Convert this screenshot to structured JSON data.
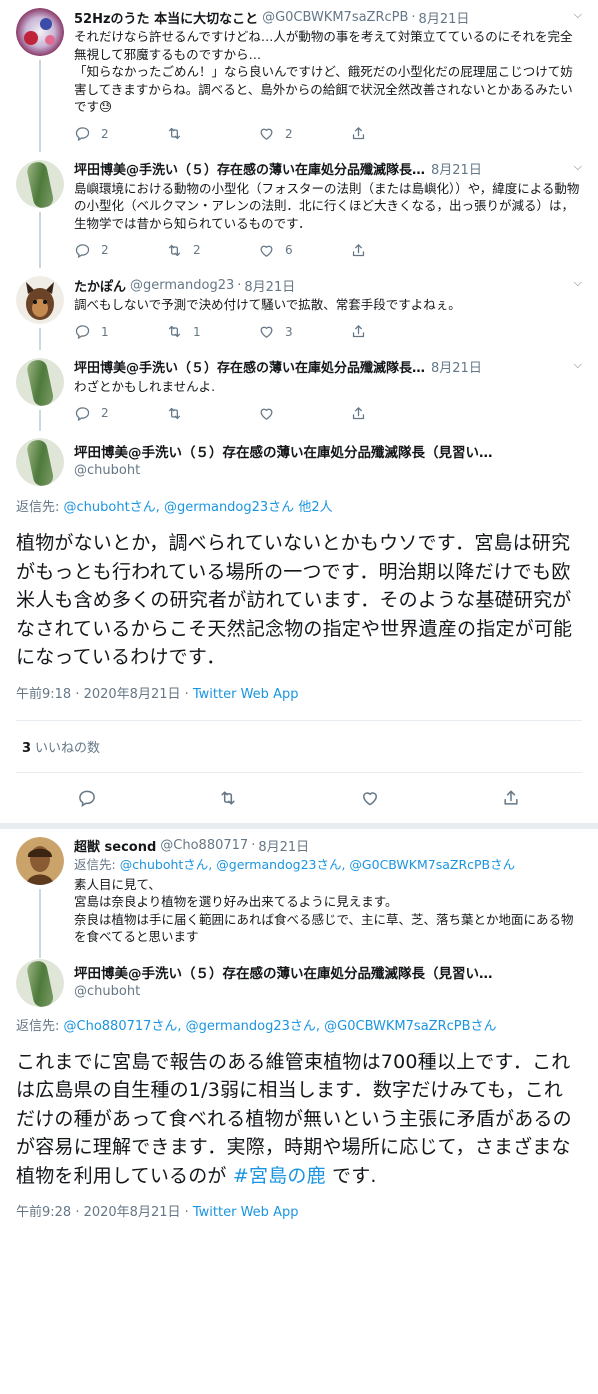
{
  "tweets": [
    {
      "name": "52Hzのうた 本当に大切なこと",
      "handle": "@G0CBWKM7saZRcPB",
      "date": "8月21日",
      "text": "それだけなら許せるんですけどね…人が動物の事を考えて対策立てているのにそれを完全無視して邪魔するものですから…\n「知らなかったごめん！」なら良いんですけど、餓死だの小型化だの屁理屈こじつけて妨害してきますからね。調べると、島外からの給餌で状況全然改善されないとかあるみたいです😓",
      "replies": "2",
      "retweets": "",
      "likes": "2"
    },
    {
      "name": "坪田博美@手洗い（５）存在感の薄い在庫処分品殲滅隊長…",
      "handle": "",
      "date": "8月21日",
      "text": "島嶼環境における動物の小型化（フォスターの法則（または島嶼化））や，緯度による動物の小型化（ベルクマン・アレンの法則．北に行くほど大きくなる，出っ張りが減る）は，生物学では昔から知られているものです．",
      "replies": "2",
      "retweets": "2",
      "likes": "6"
    },
    {
      "name": "たかぽん",
      "handle": "@germandog23",
      "date": "8月21日",
      "text": "調べもしないで予測で決め付けて騒いで拡散、常套手段ですよねぇ。",
      "replies": "1",
      "retweets": "1",
      "likes": "3"
    },
    {
      "name": "坪田博美@手洗い（５）存在感の薄い在庫処分品殲滅隊長…",
      "handle": "",
      "date": "8月21日",
      "text": "わざとかもしれませんよ.",
      "replies": "2",
      "retweets": "",
      "likes": ""
    }
  ],
  "main1": {
    "name": "坪田博美@手洗い（５）存在感の薄い在庫処分品殲滅隊長（見習い…",
    "handle": "@chuboht",
    "reply_prefix": "返信先: ",
    "reply_links": "@chubohtさん, @germandog23さん",
    "reply_more": " 他2人",
    "text": "植物がないとか，調べられていないとかもウソです．宮島は研究がもっとも行われている場所の一つです．明治期以降だけでも欧米人も含め多くの研究者が訪れています．そのような基礎研究がなされているからこそ天然記念物の指定や世界遺産の指定が可能になっているわけです．",
    "time": "午前9:18 · 2020年8月21日 · ",
    "source": "Twitter Web App",
    "likes_count": "3",
    "likes_label": "いいねの数"
  },
  "tweet5": {
    "name": "超獣 second",
    "handle": "@Cho880717",
    "date": "8月21日",
    "reply_prefix": "返信先: ",
    "reply_links": "@chubohtさん, @germandog23さん, @G0CBWKM7saZRcPBさん",
    "text": "素人目に見て、\n宮島は奈良より植物を選り好み出来てるように見えます。\n奈良は植物は手に届く範囲にあれば食べる感じで、主に草、芝、落ち葉とか地面にある物を食べてると思います"
  },
  "main2": {
    "name": "坪田博美@手洗い（５）存在感の薄い在庫処分品殲滅隊長（見習い…",
    "handle": "@chuboht",
    "reply_prefix": "返信先: ",
    "reply_links": "@Cho880717さん, @germandog23さん, @G0CBWKM7saZRcPBさん",
    "text_before": "これまでに宮島で報告のある維管束植物は700種以上です．これは広島県の自生種の1/3弱に相当します．数字だけみても，これだけの種があって食べれる植物が無いという主張に矛盾があるのが容易に理解できます．実際，時期や場所に応じて，さまざまな植物を利用しているのが ",
    "hashtag": "#宮島の鹿",
    "text_after": " です.",
    "time": "午前9:28 · 2020年8月21日 · ",
    "source": "Twitter Web App"
  },
  "colors": {
    "link": "#1b95e0",
    "muted": "#657786",
    "thread": "#ccd6dd"
  }
}
